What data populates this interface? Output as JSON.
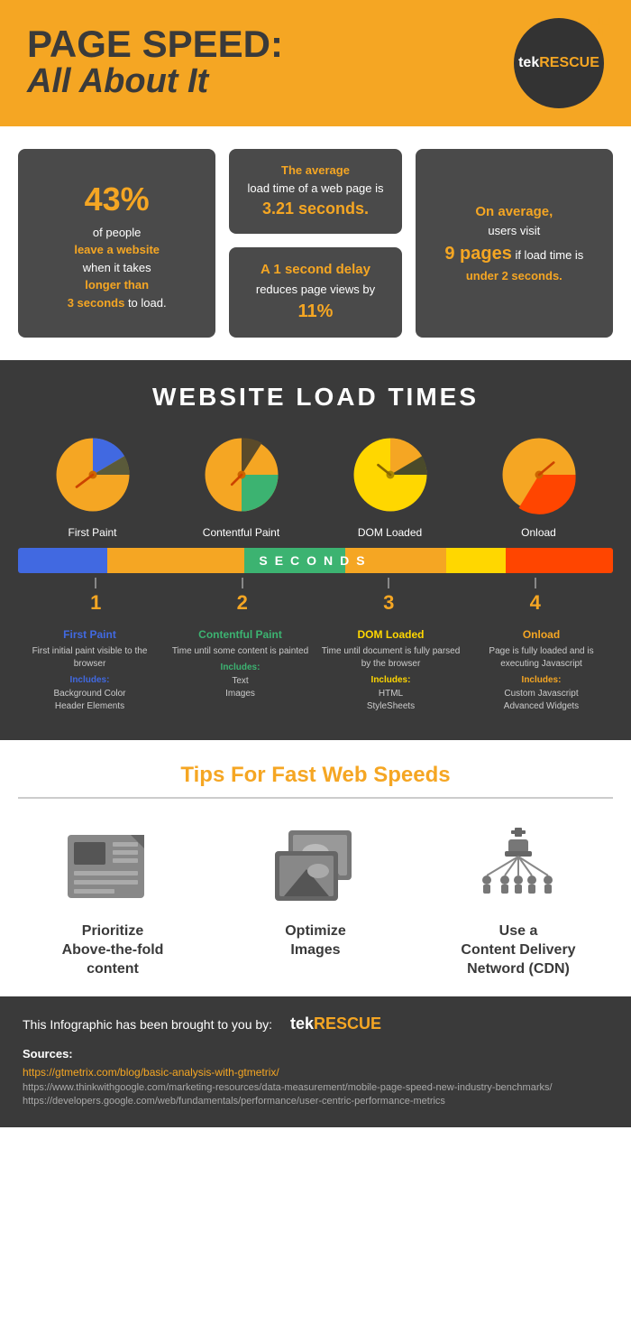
{
  "header": {
    "line1": "PAGE SPEED:",
    "line2": "All About It",
    "logo_tek": "tek",
    "logo_rescue": "RESCUE",
    "logo_plus": "+"
  },
  "stats": {
    "box1_percent": "43%",
    "box1_text1": "of people",
    "box1_highlight1": "leave a website",
    "box1_text2": "when it takes",
    "box1_highlight2": "longer than",
    "box1_highlight3": "3 seconds",
    "box1_text3": "to load.",
    "box2_text1": "The average",
    "box2_highlight1": "load time of a web page is",
    "box2_highlight2": "3.21 seconds.",
    "box3_text1": "A 1 second delay",
    "box3_highlight1": "reduces",
    "box3_text2": "page views by",
    "box3_highlight2": "11%",
    "box4_text1": "On average,",
    "box4_text2": "users visit",
    "box4_highlight1": "9 pages",
    "box4_text3": "if load time is",
    "box4_highlight2": "under 2 seconds."
  },
  "load_section": {
    "title": "WEBSITE LOAD TIMES",
    "charts": [
      {
        "label": "First Paint"
      },
      {
        "label": "Contentful Paint"
      },
      {
        "label": "DOM Loaded"
      },
      {
        "label": "Onload"
      }
    ],
    "bar_label": "SECONDS",
    "numbers": [
      "1",
      "2",
      "3",
      "4"
    ],
    "descriptions": [
      {
        "title": "First Paint",
        "color": "blue",
        "desc": "First initial paint visible to the browser",
        "includes_label": "Includes:",
        "includes": "Background Color\nHeader Elements"
      },
      {
        "title": "Contentful Paint",
        "color": "green",
        "desc": "Time until some content is painted",
        "includes_label": "Includes:",
        "includes": "Text\nImages"
      },
      {
        "title": "DOM Loaded",
        "color": "yellow",
        "desc": "Time until document is fully parsed by the browser",
        "includes_label": "Includes:",
        "includes": "HTML\nStyleSheets"
      },
      {
        "title": "Onload",
        "color": "orange",
        "desc": "Page is fully loaded and is executing Javascript",
        "includes_label": "Includes:",
        "includes": "Custom Javascript\nAdvanced Widgets"
      }
    ]
  },
  "tips": {
    "title": "Tips For Fast Web Speeds",
    "items": [
      {
        "label": "Prioritize\nAbove-the-fold\ncontent"
      },
      {
        "label": "Optimize\nImages"
      },
      {
        "label": "Use a\nContent Delivery\nNetword (CDN)"
      }
    ]
  },
  "footer": {
    "credit_text": "This Infographic has been brought to you by:",
    "logo_tek": "tek",
    "logo_rescue": "RESCUE",
    "sources_title": "Sources:",
    "source1": "https://gtmetrix.com/blog/basic-analysis-with-gtmetrix/",
    "source2": "https://www.thinkwithgoogle.com/marketing-resources/data-measurement/mobile-page-speed-new-industry-benchmarks/",
    "source3": "https://developers.google.com/web/fundamentals/performance/user-centric-performance-metrics"
  }
}
